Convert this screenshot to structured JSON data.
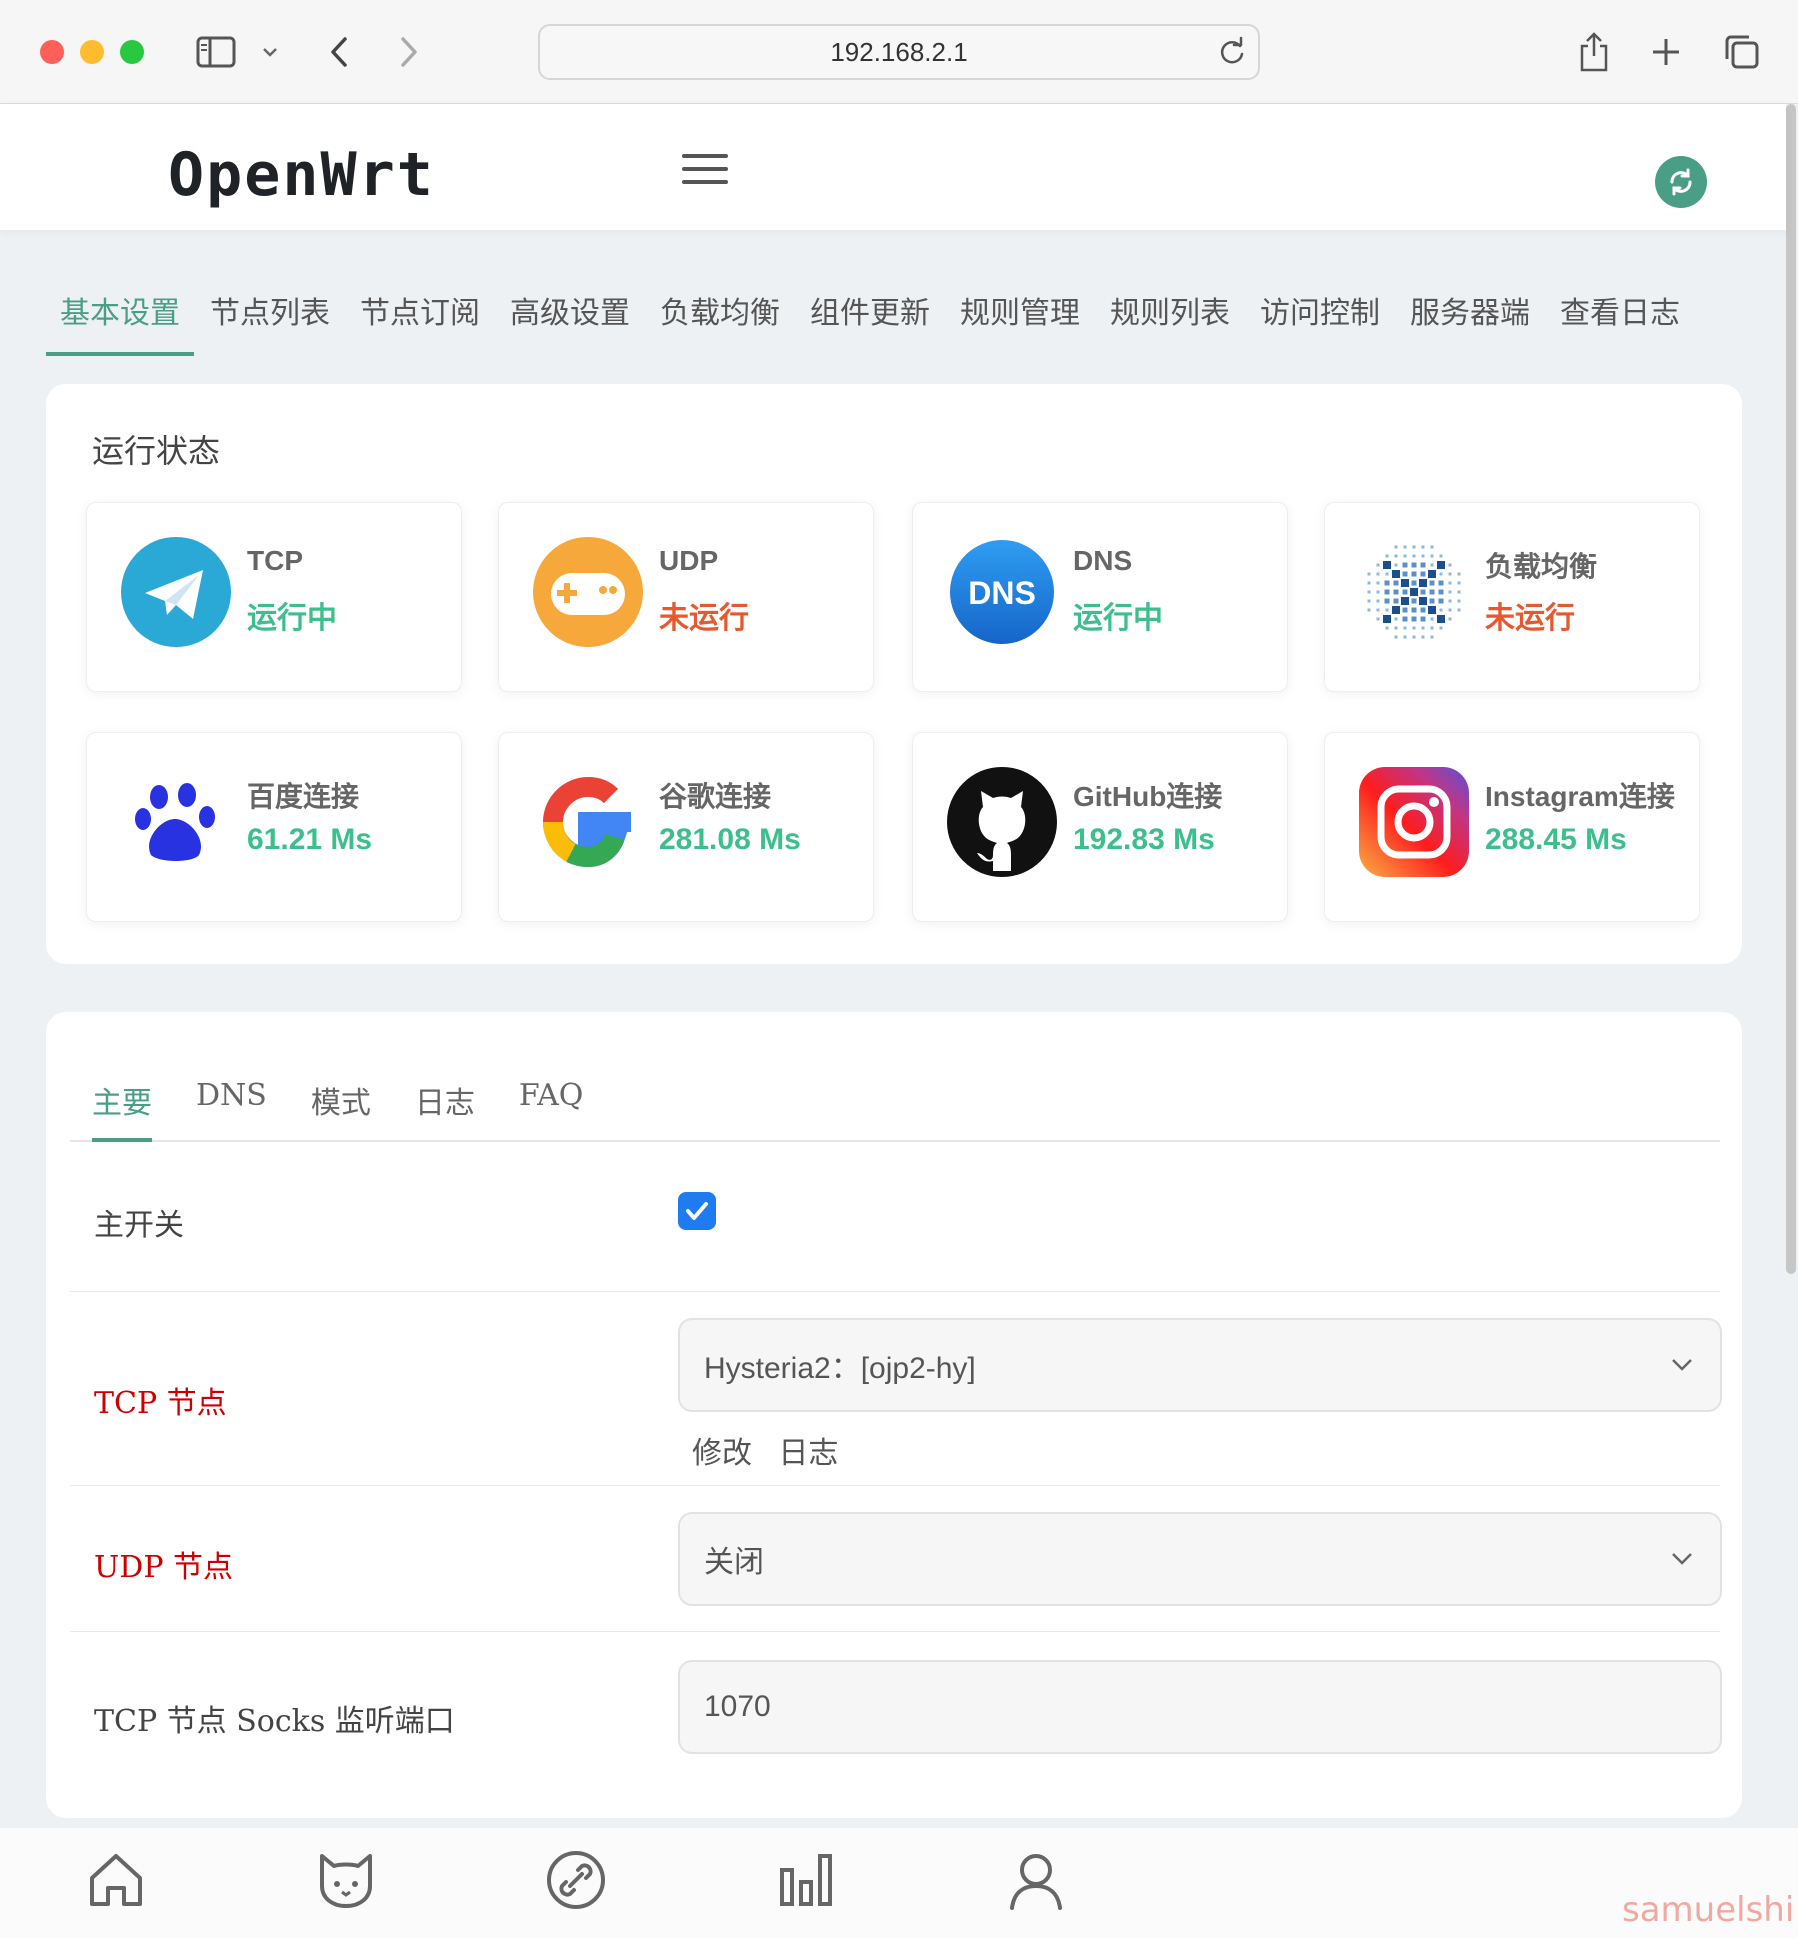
{
  "browser": {
    "url": "192.168.2.1"
  },
  "header": {
    "brand": "OpenWrt"
  },
  "nav_tabs": [
    {
      "label": "基本设置",
      "active": true
    },
    {
      "label": "节点列表"
    },
    {
      "label": "节点订阅"
    },
    {
      "label": "高级设置"
    },
    {
      "label": "负载均衡"
    },
    {
      "label": "组件更新"
    },
    {
      "label": "规则管理"
    },
    {
      "label": "规则列表"
    },
    {
      "label": "访问控制"
    },
    {
      "label": "服务器端"
    },
    {
      "label": "查看日志"
    }
  ],
  "status": {
    "title": "运行状态",
    "tiles": [
      {
        "label": "TCP",
        "value": "运行中",
        "icon": "telegram-icon"
      },
      {
        "label": "UDP",
        "value": "未运行",
        "icon": "gamepad-icon"
      },
      {
        "label": "DNS",
        "value": "运行中",
        "icon": "dns-icon",
        "icon_text": "DNS"
      },
      {
        "label": "负载均衡",
        "value": "未运行",
        "icon": "load-balance-icon"
      },
      {
        "label": "百度连接",
        "value": "61.21 Ms",
        "icon": "baidu-icon"
      },
      {
        "label": "谷歌连接",
        "value": "281.08 Ms",
        "icon": "google-icon"
      },
      {
        "label": "GitHub连接",
        "value": "192.83 Ms",
        "icon": "github-icon"
      },
      {
        "label": "Instagram连接",
        "value": "288.45 Ms",
        "icon": "instagram-icon"
      }
    ]
  },
  "settings": {
    "tabs": [
      {
        "label": "主要",
        "active": true
      },
      {
        "label": "DNS"
      },
      {
        "label": "模式"
      },
      {
        "label": "日志"
      },
      {
        "label": "FAQ"
      }
    ],
    "main_switch": {
      "label": "主开关",
      "checked": true
    },
    "tcp_node": {
      "label": "TCP 节点",
      "value": "Hysteria2：[ojp2-hy]",
      "links": [
        "修改",
        "日志"
      ]
    },
    "udp_node": {
      "label": "UDP 节点",
      "value": "关闭"
    },
    "socks_port": {
      "label": "TCP 节点 Socks 监听端口",
      "value": "1070"
    }
  },
  "colors": {
    "accent": "#4a9e86",
    "running": "#3cbf8c",
    "stopped": "#e8582e",
    "required_label": "#cc0000"
  },
  "watermark": "samuelshi"
}
